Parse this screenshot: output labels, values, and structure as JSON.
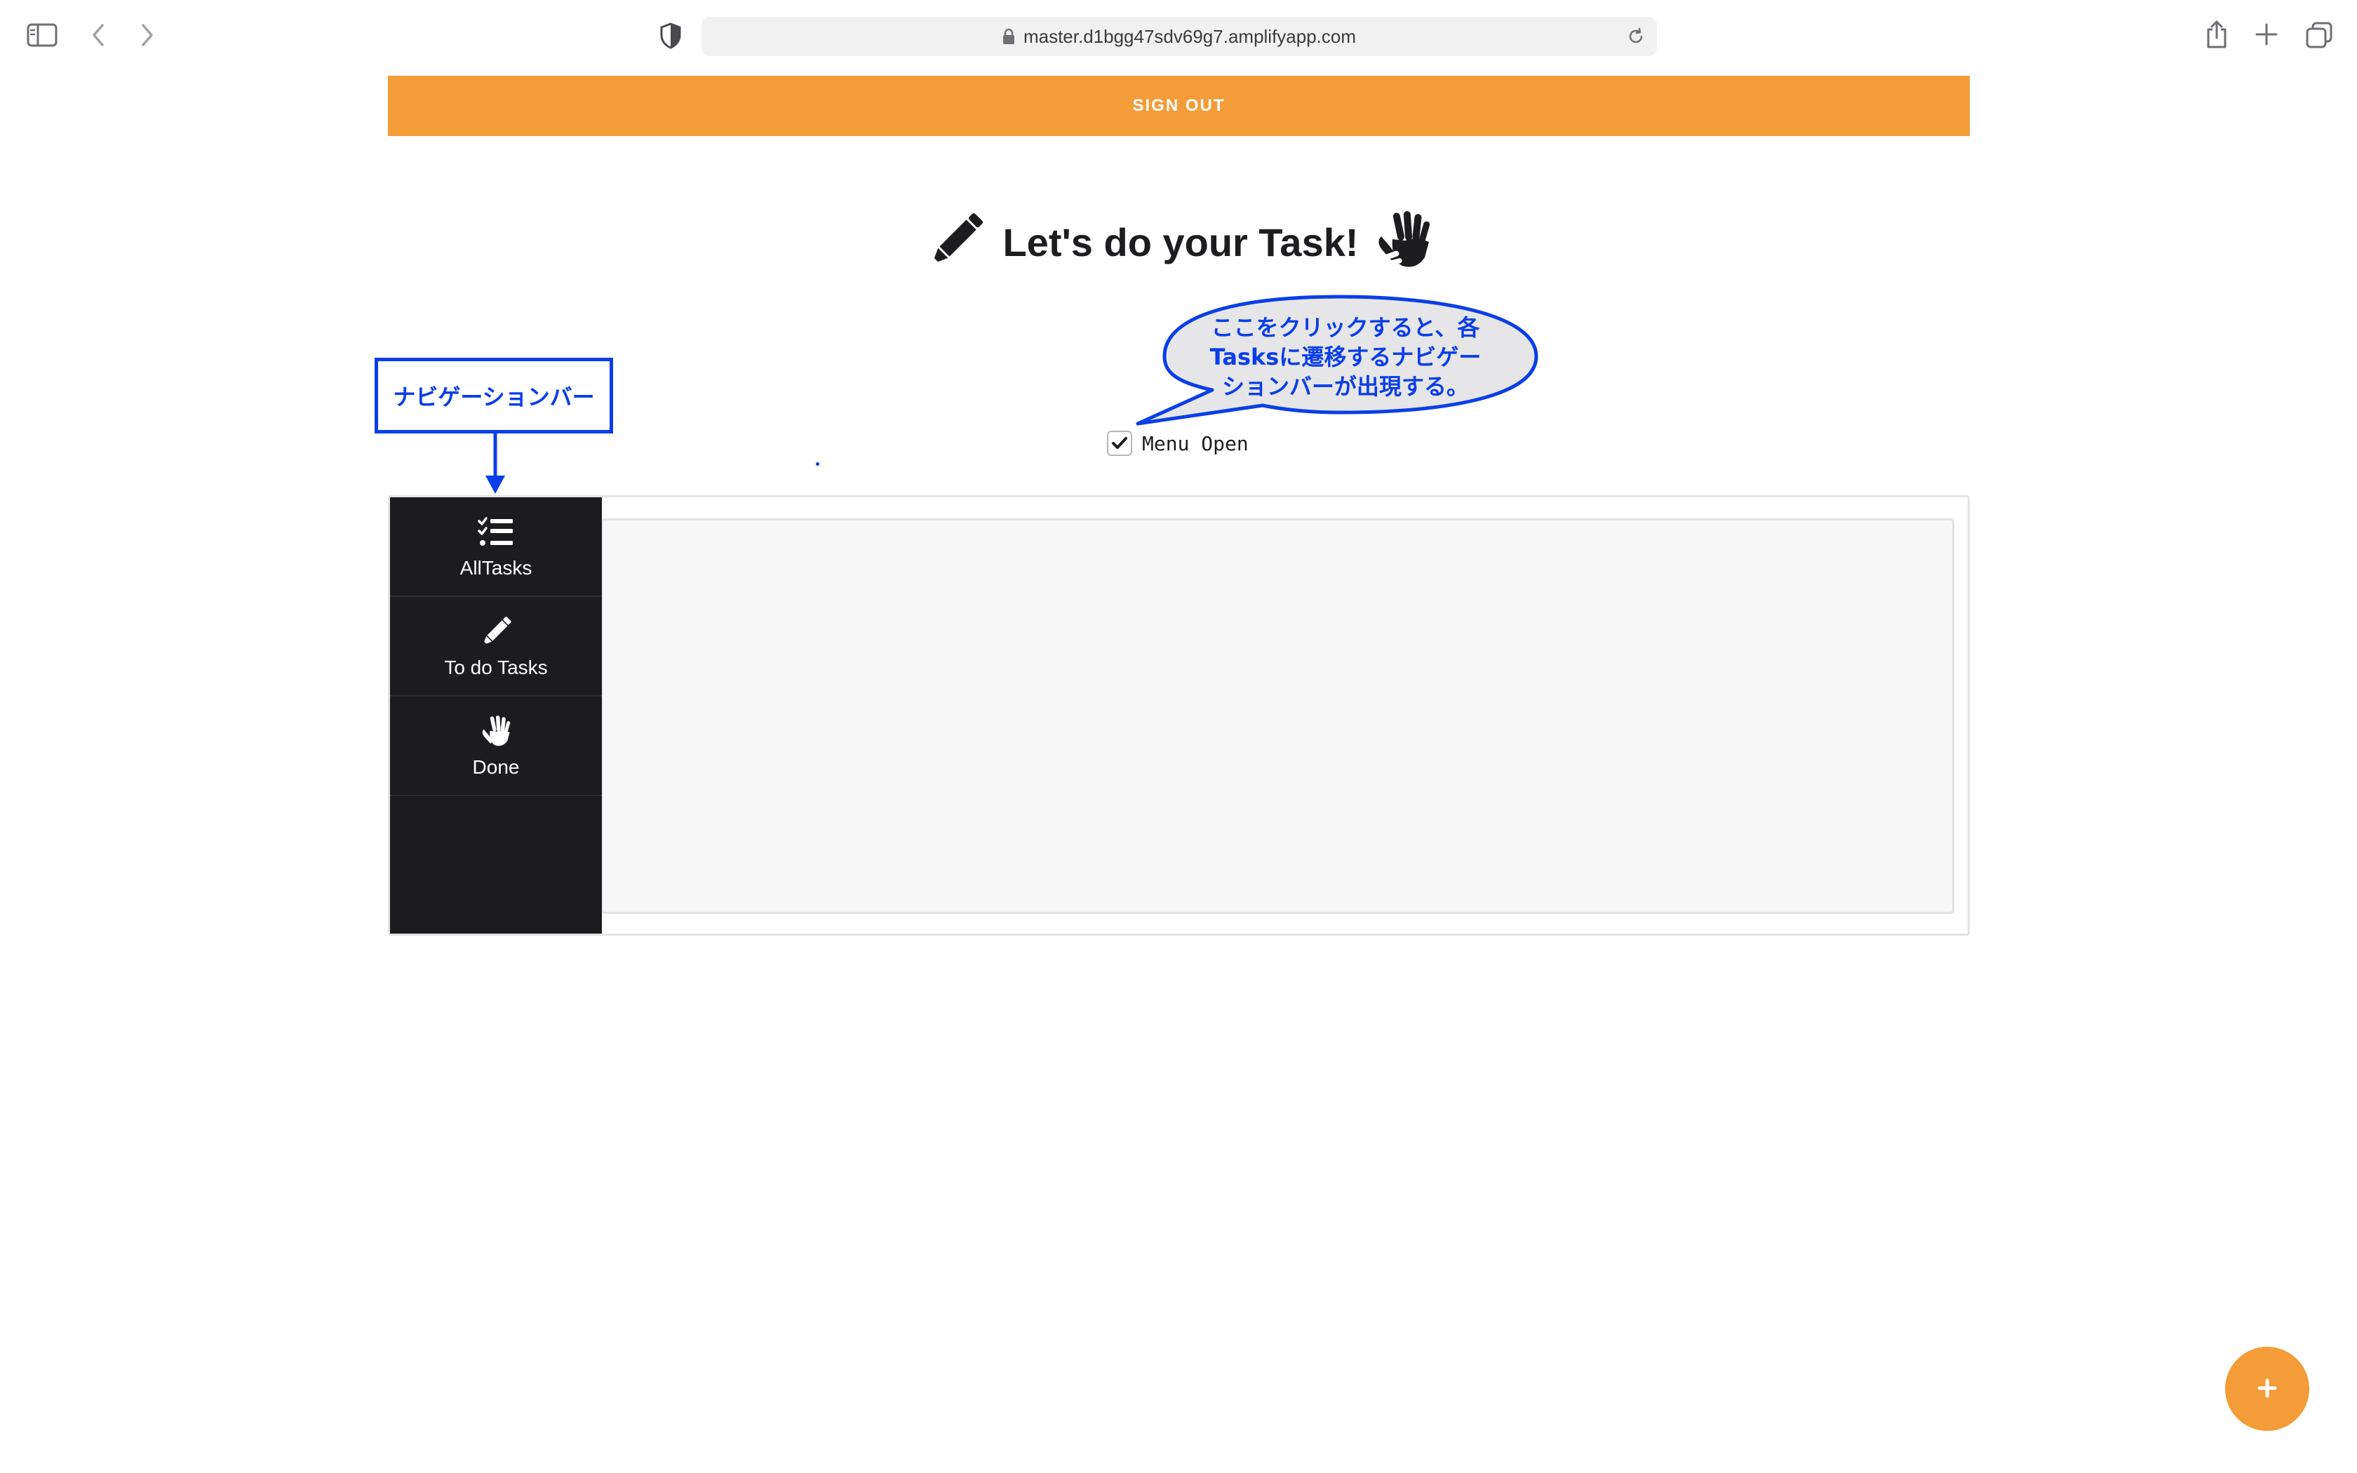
{
  "browser": {
    "url": "master.d1bgg47sdv69g7.amplifyapp.com",
    "icons": [
      "sidebar-toggle-icon",
      "back-icon",
      "forward-icon",
      "shield-icon",
      "lock-icon",
      "reload-icon",
      "share-icon",
      "new-tab-icon",
      "tab-overview-icon"
    ]
  },
  "header": {
    "signout_label": "SIGN OUT",
    "title": "Let's do your Task!",
    "title_icons": [
      "pencil-icon",
      "hand-icon"
    ]
  },
  "annotations": {
    "nav_label": "ナビゲーションバー",
    "callout_lines": [
      "ここをクリックすると、各",
      "Tasksに遷移するナビゲー",
      "ションバーが出現する。"
    ]
  },
  "menu_toggle": {
    "label": "Menu Open",
    "checked": true
  },
  "sidebar": {
    "items": [
      {
        "label": "AllTasks",
        "icon": "task-list-icon"
      },
      {
        "label": "To do Tasks",
        "icon": "pencil-icon"
      },
      {
        "label": "Done",
        "icon": "hand-icon"
      }
    ]
  },
  "fab": {
    "label": "+",
    "icon": "plus-icon"
  },
  "colors": {
    "accent": "#f39c38",
    "sidebar_bg": "#1c1c1e",
    "annotation_blue": "#0a3ee8",
    "callout_fill": "#e6e6e8"
  }
}
